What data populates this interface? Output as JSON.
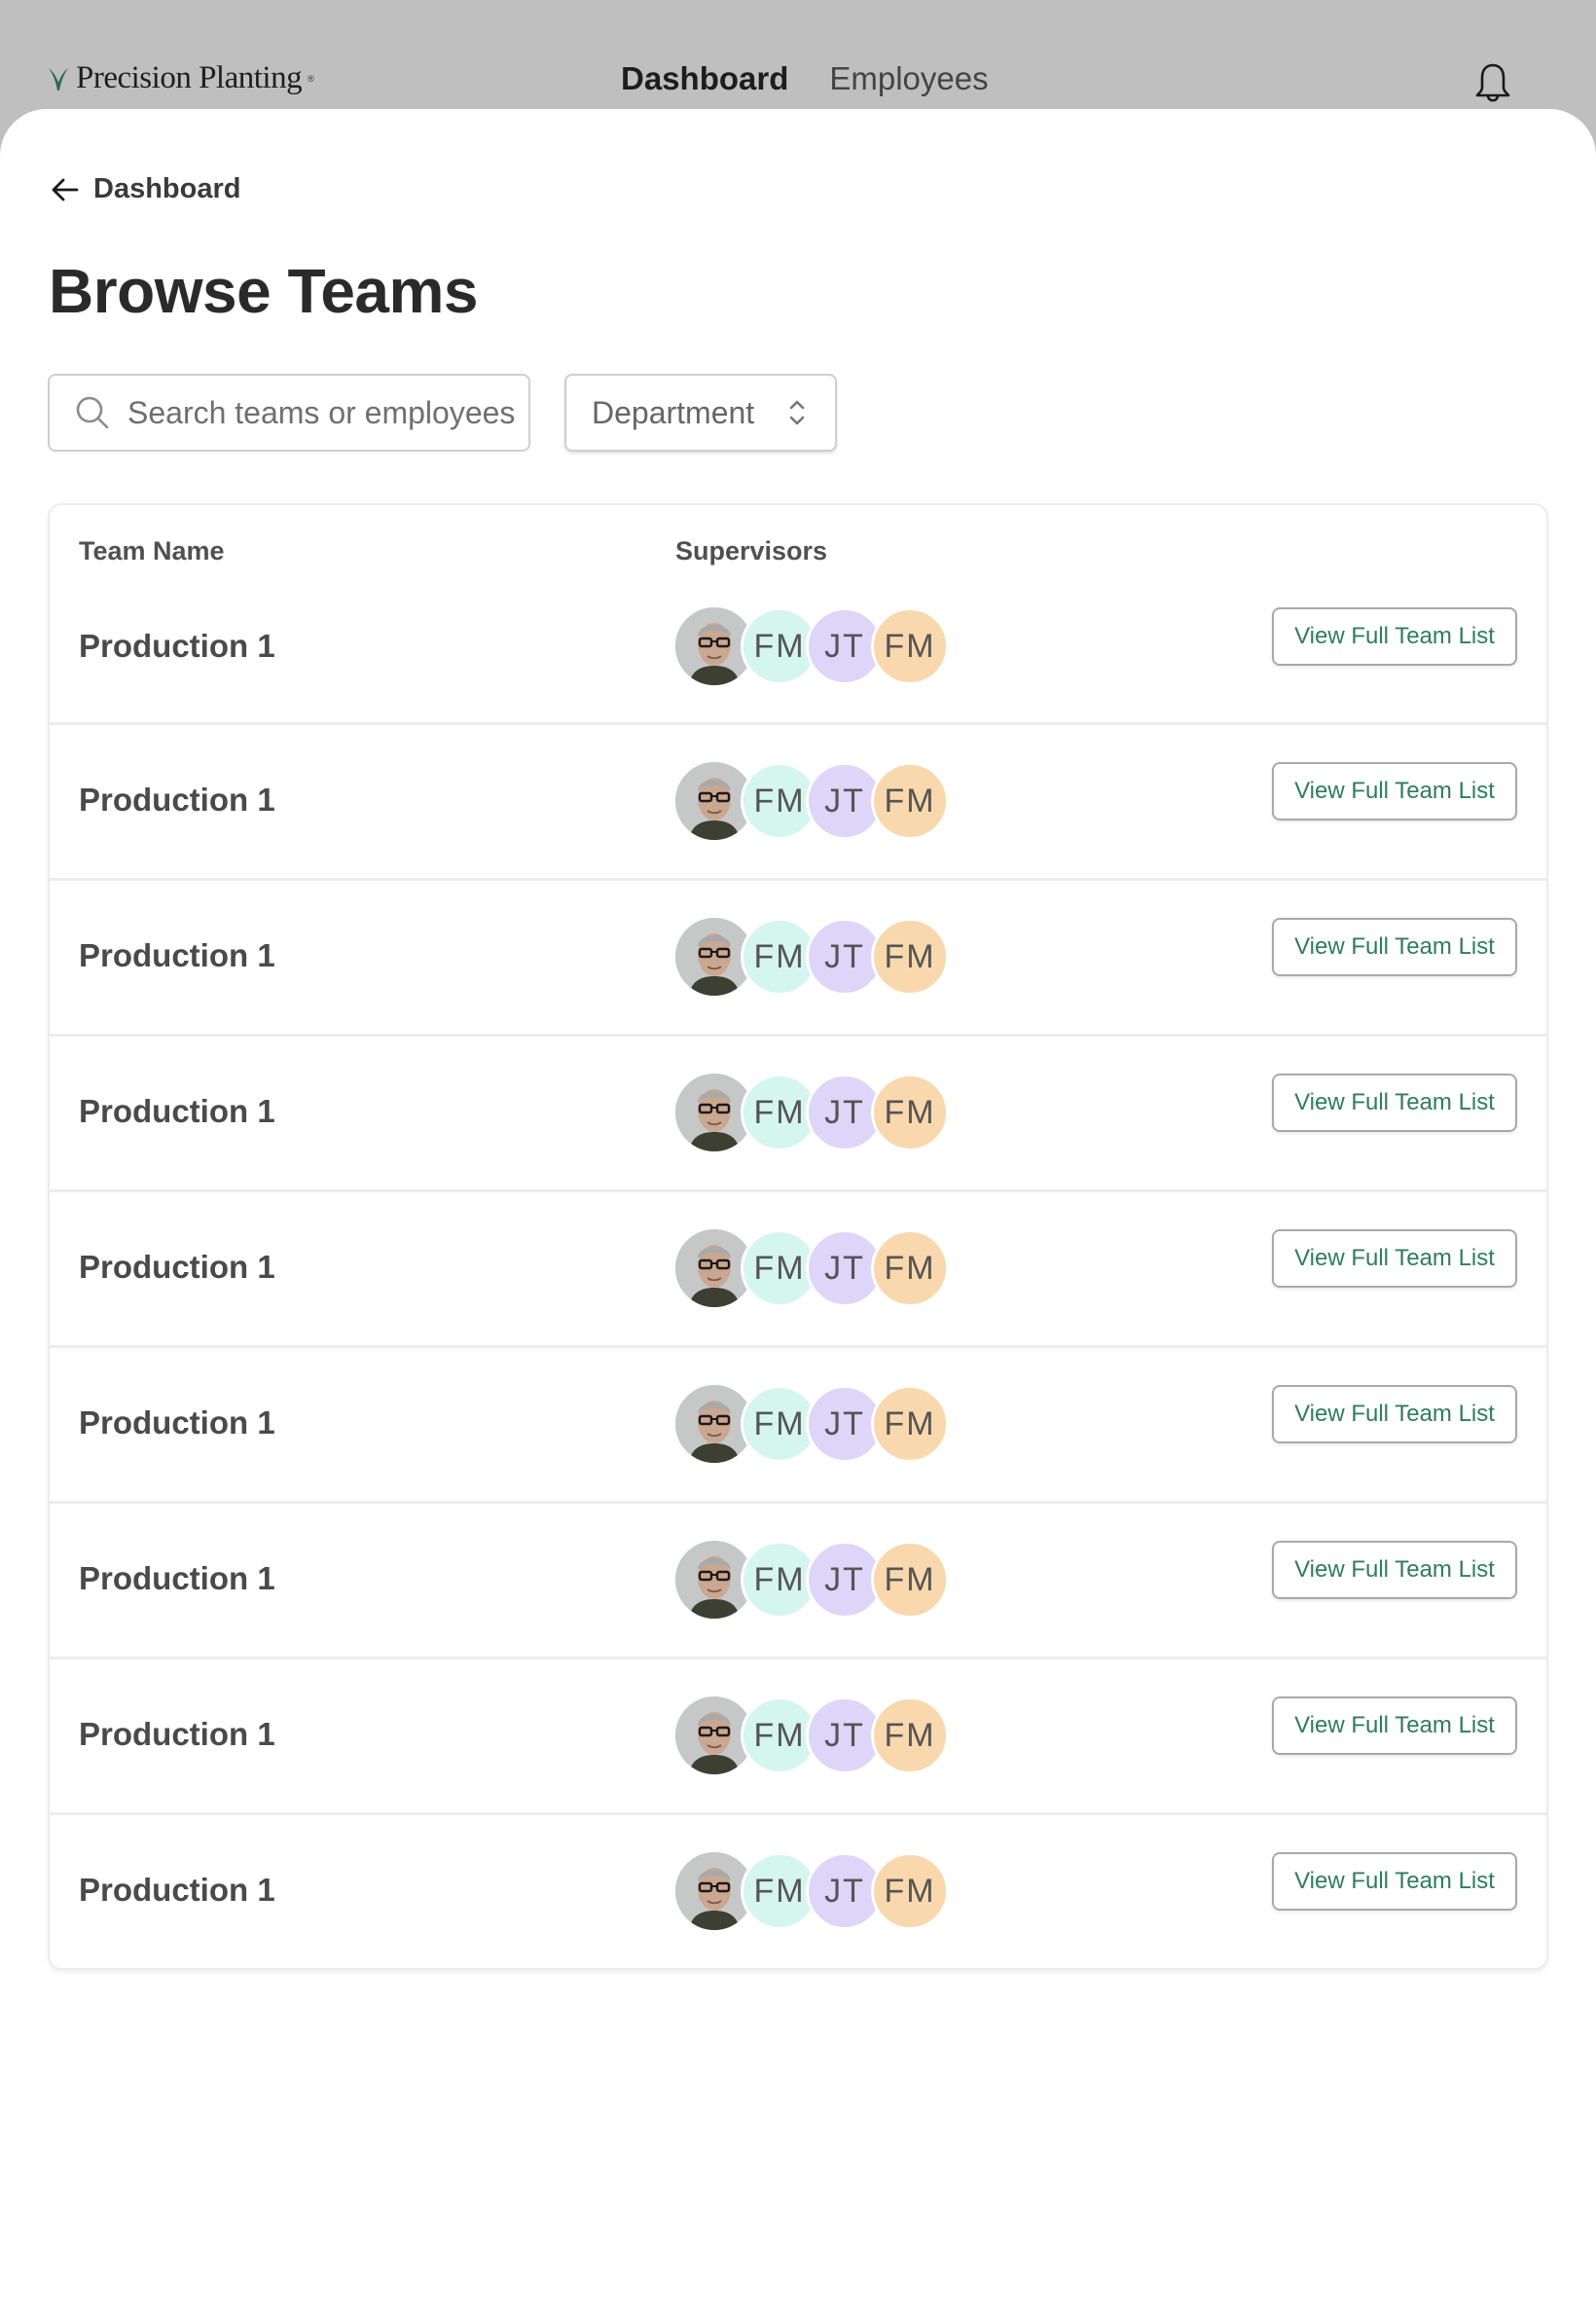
{
  "brand": {
    "name": "Precision Planting",
    "registered": "®",
    "accent": "#2e6b4a"
  },
  "nav": {
    "items": [
      {
        "label": "Dashboard",
        "active": true
      },
      {
        "label": "Employees",
        "active": false
      }
    ],
    "notifications_icon": "bell-icon"
  },
  "page": {
    "back_label": "Dashboard",
    "title": "Browse Teams"
  },
  "filters": {
    "search": {
      "value": "",
      "placeholder": "Search teams or employees"
    },
    "department": {
      "selected": "Department"
    }
  },
  "table": {
    "columns": [
      "Team Name",
      "Supervisors"
    ],
    "action_label": "View Full Team List",
    "avatar_colors": {
      "mint": "#d4f6ee",
      "lavender": "#ddd6f8",
      "peach": "#f8d8ac"
    },
    "rows": [
      {
        "name": "Production 1",
        "supervisors": [
          {
            "type": "photo"
          },
          {
            "initials": "FM",
            "color": "mint"
          },
          {
            "initials": "JT",
            "color": "lavender"
          },
          {
            "initials": "FM",
            "color": "peach"
          }
        ]
      },
      {
        "name": "Production 1",
        "supervisors": [
          {
            "type": "photo"
          },
          {
            "initials": "FM",
            "color": "mint"
          },
          {
            "initials": "JT",
            "color": "lavender"
          },
          {
            "initials": "FM",
            "color": "peach"
          }
        ]
      },
      {
        "name": "Production 1",
        "supervisors": [
          {
            "type": "photo"
          },
          {
            "initials": "FM",
            "color": "mint"
          },
          {
            "initials": "JT",
            "color": "lavender"
          },
          {
            "initials": "FM",
            "color": "peach"
          }
        ]
      },
      {
        "name": "Production 1",
        "supervisors": [
          {
            "type": "photo"
          },
          {
            "initials": "FM",
            "color": "mint"
          },
          {
            "initials": "JT",
            "color": "lavender"
          },
          {
            "initials": "FM",
            "color": "peach"
          }
        ]
      },
      {
        "name": "Production 1",
        "supervisors": [
          {
            "type": "photo"
          },
          {
            "initials": "FM",
            "color": "mint"
          },
          {
            "initials": "JT",
            "color": "lavender"
          },
          {
            "initials": "FM",
            "color": "peach"
          }
        ]
      },
      {
        "name": "Production 1",
        "supervisors": [
          {
            "type": "photo"
          },
          {
            "initials": "FM",
            "color": "mint"
          },
          {
            "initials": "JT",
            "color": "lavender"
          },
          {
            "initials": "FM",
            "color": "peach"
          }
        ]
      },
      {
        "name": "Production 1",
        "supervisors": [
          {
            "type": "photo"
          },
          {
            "initials": "FM",
            "color": "mint"
          },
          {
            "initials": "JT",
            "color": "lavender"
          },
          {
            "initials": "FM",
            "color": "peach"
          }
        ]
      },
      {
        "name": "Production 1",
        "supervisors": [
          {
            "type": "photo"
          },
          {
            "initials": "FM",
            "color": "mint"
          },
          {
            "initials": "JT",
            "color": "lavender"
          },
          {
            "initials": "FM",
            "color": "peach"
          }
        ]
      },
      {
        "name": "Production 1",
        "supervisors": [
          {
            "type": "photo"
          },
          {
            "initials": "FM",
            "color": "mint"
          },
          {
            "initials": "JT",
            "color": "lavender"
          },
          {
            "initials": "FM",
            "color": "peach"
          }
        ]
      }
    ]
  }
}
